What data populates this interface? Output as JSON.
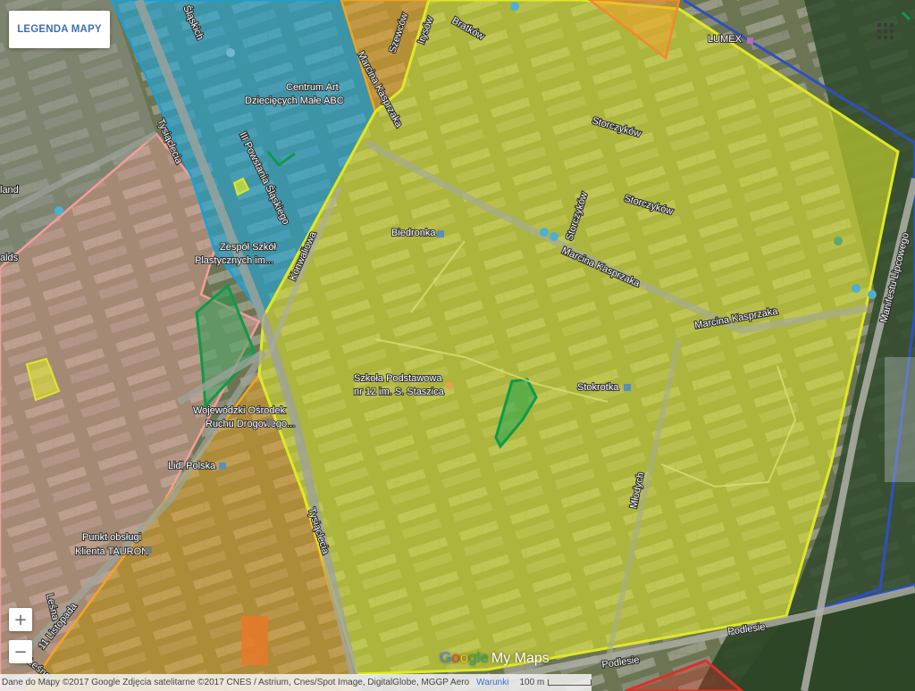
{
  "legend_button": {
    "label": "LEGENDA MAPY"
  },
  "zoom": {
    "in_label": "+",
    "out_label": "−"
  },
  "brand": {
    "g1": "G",
    "g2": "o",
    "g3": "o",
    "g4": "gle",
    "rest": "My Maps"
  },
  "attribution": {
    "text": "Dane do Mapy ©2017 Google Zdjęcia satelitarne ©2017 CNES / Astrium, Cnes/Spot Image, DigitalGlobe, MGGP Aero",
    "terms": "Warunki",
    "scale": "100 m"
  },
  "street_labels": {
    "tysiaclecia_top": "Tysiąclecia",
    "tysiaclecia_bottom": "Tysiąclecia",
    "slaskich": "Śląskich",
    "powstancow": "III Powstania Śląskiego",
    "marcina_kasprzaka_top": "Marcina Kasprzaka",
    "marcina_kasprzaka_mid": "Marcina Kasprzaka",
    "marcina_kasprzaka_right": "Marcina Kasprzaka",
    "storczykow_1": "Storczyków",
    "storczykow_2": "Storczyków",
    "storczykow_3": "Storczyków",
    "bratkow": "Bratków",
    "irysow": "Irysów",
    "szewcow": "Szewców",
    "konwaliowa": "Konwaliowa",
    "mlodych": "Młodych",
    "manifestu": "Manifestu Lipcowego",
    "listopada": "11 Listopada",
    "lesna": "Leśna",
    "lesna2": "Leśna",
    "podlesie": "Podlesie",
    "podlesie2": "Podlesie",
    "land": "land",
    "alds": "alds"
  },
  "poi_labels": {
    "centrum_art": "Centrum Art",
    "centrum_art2": "Dziecięcych Małe ABC",
    "zespol": "Zespół Szkół",
    "zespol2": "Plastycznych im...",
    "biedronka": "Biedronka",
    "szkola": "Szkoła Podstawowa",
    "szkola2": "nr 12 im. S. Staszica",
    "stokrotka": "Stokrotka",
    "wojewodzki": "Wojewódzki Ośrodek",
    "wojewodzki2": "Ruchu Drogowego...",
    "lidl": "Lidl Polska",
    "punkt": "Punkt obsługi",
    "punkt2": "Klienta TAURON",
    "lumex": "LUMEX"
  },
  "colors": {
    "yellow_zone": "#e0ea2a",
    "blue_zone": "#1fa6d9",
    "orange_zone": "#f2a41d",
    "pink_zone": "#f29a9a",
    "green_zone": "#12a352",
    "navy_zone": "#3050c0",
    "red_zone": "#d8322b"
  }
}
